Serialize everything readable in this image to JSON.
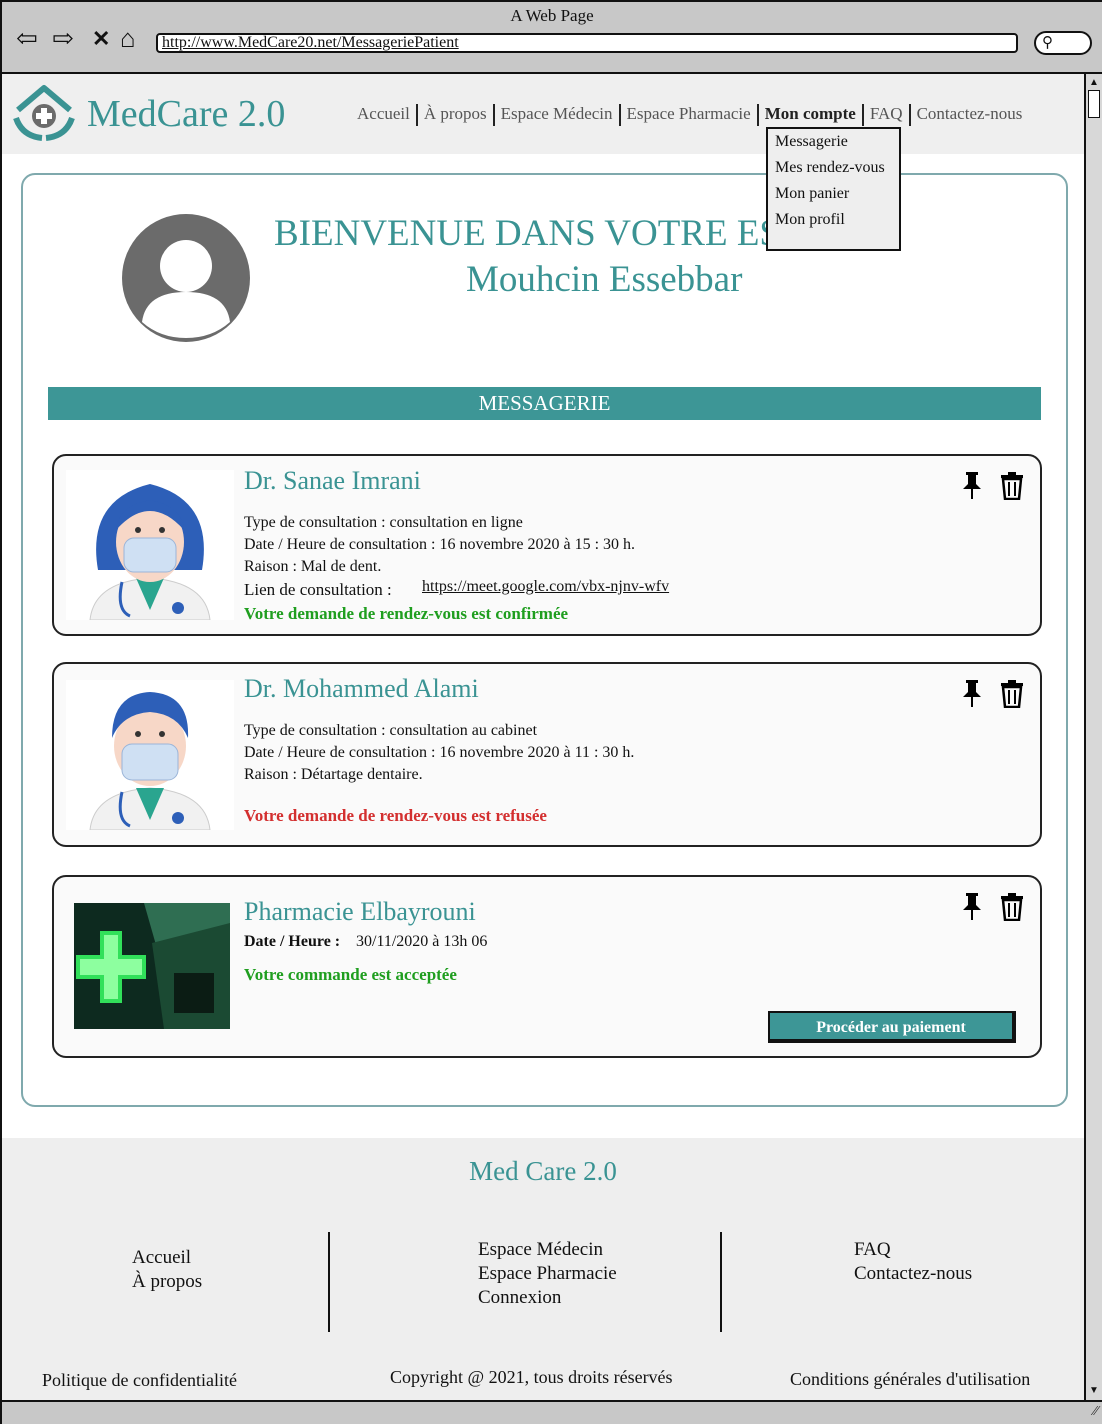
{
  "window": {
    "title": "A Web Page",
    "url": "http://www.MedCare20.net/MessageriePatient"
  },
  "header": {
    "brand": "MedCare 2.0",
    "menu": [
      "Accueil",
      "À propos",
      "Espace Médecin",
      "Espace Pharmacie",
      "Mon compte",
      "FAQ",
      "Contactez-nous"
    ],
    "dropdown": [
      "Messagerie",
      "Mes rendez-vous",
      "Mon panier",
      "Mon profil"
    ]
  },
  "welcome": {
    "title": "BIENVENUE DANS VOTRE ESPACE !",
    "name": "Mouhcin Essebbar"
  },
  "section": {
    "title": "MESSAGERIE"
  },
  "messages": [
    {
      "title": "Dr. Sanae Imrani",
      "type": "Type de consultation : consultation en ligne",
      "date": "Date / Heure de consultation : 16 novembre 2020 à 15 : 30 h.",
      "reason": "Raison : Mal de dent.",
      "link_label": "Lien de consultation :",
      "link": "https://meet.google.com/vbx-njnv-wfv",
      "status": "Votre demande de rendez-vous est confirmée"
    },
    {
      "title": "Dr. Mohammed Alami",
      "type": "Type de consultation : consultation au cabinet",
      "date": "Date / Heure de consultation : 16 novembre 2020 à 11 : 30 h.",
      "reason": "Raison : Détartage dentaire.",
      "status": "Votre demande de rendez-vous est refusée"
    },
    {
      "title": "Pharmacie Elbayrouni",
      "date_label": "Date / Heure :",
      "date_value": "30/11/2020 à 13h 06",
      "status": "Votre commande est acceptée",
      "button": "Procéder au paiement"
    }
  ],
  "footer": {
    "title": "Med Care 2.0",
    "col1": [
      "Accueil",
      "À propos"
    ],
    "col2": [
      "Espace Médecin",
      "Espace Pharmacie",
      "Connexion"
    ],
    "col3": [
      "FAQ",
      "Contactez-nous"
    ],
    "privacy": "Politique de confidentialité",
    "copyright": "Copyright @ 2021, tous droits réservés",
    "terms": "Conditions générales d'utilisation"
  },
  "colors": {
    "accent": "#3a9393",
    "confirmed": "#1f9e1f",
    "refused": "#d32f2f"
  }
}
